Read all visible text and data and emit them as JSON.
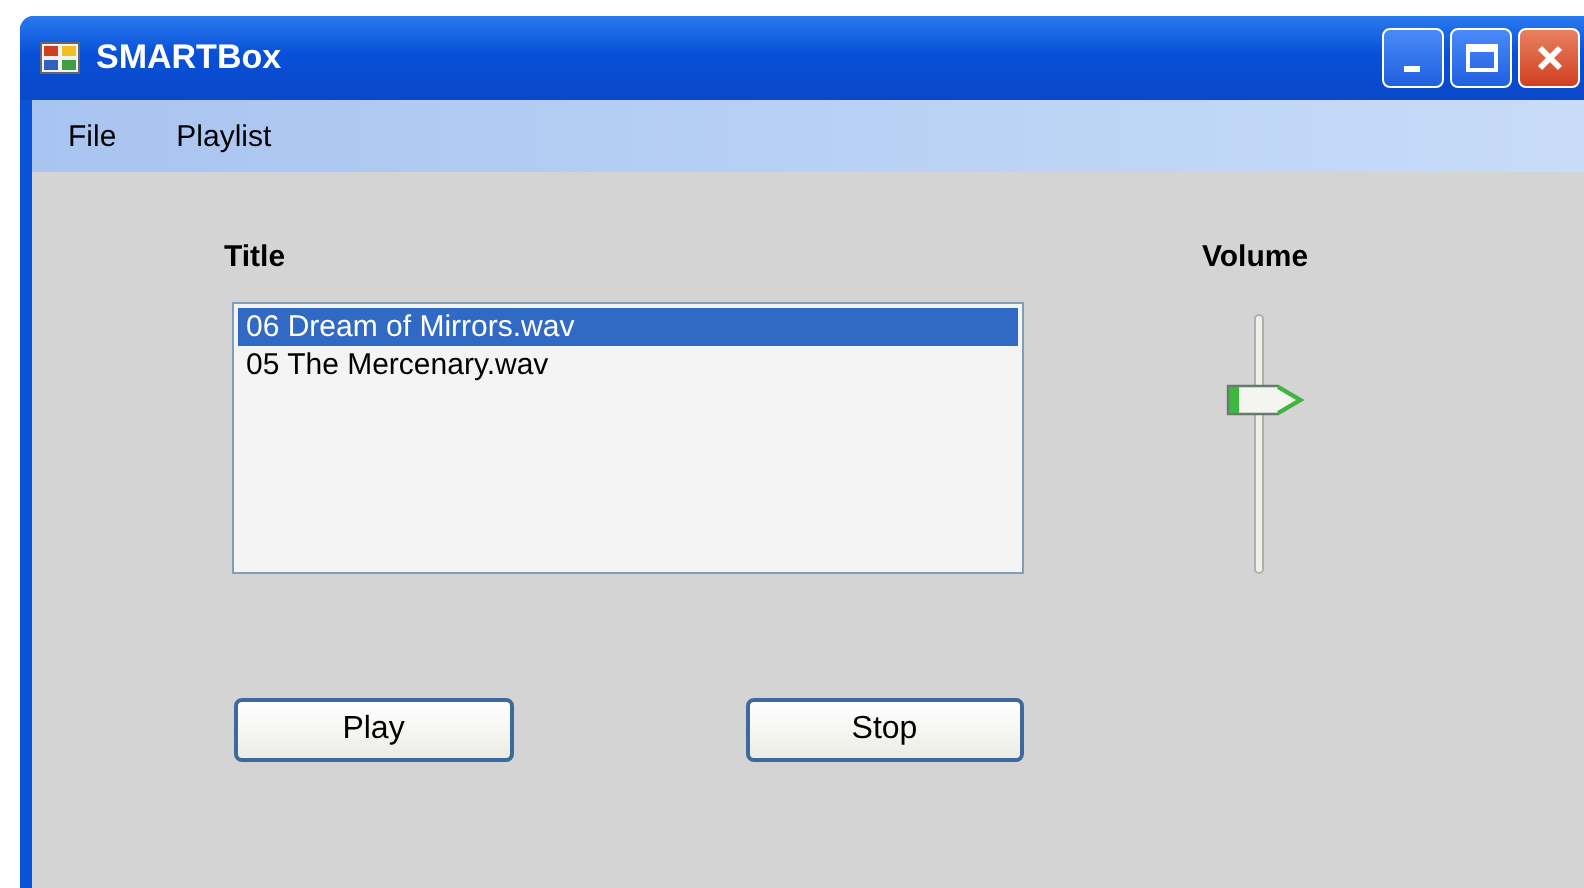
{
  "window": {
    "title": "SMARTBox"
  },
  "menu": [
    {
      "label": "File"
    },
    {
      "label": "Playlist"
    }
  ],
  "title_label": "Title",
  "playlist": [
    {
      "name": "06 Dream of Mirrors.wav",
      "selected": true
    },
    {
      "name": "05 The Mercenary.wav",
      "selected": false
    }
  ],
  "volume": {
    "label": "Volume",
    "level": 0.68
  },
  "buttons": [
    {
      "label": "Play"
    },
    {
      "label": "Stop"
    }
  ]
}
